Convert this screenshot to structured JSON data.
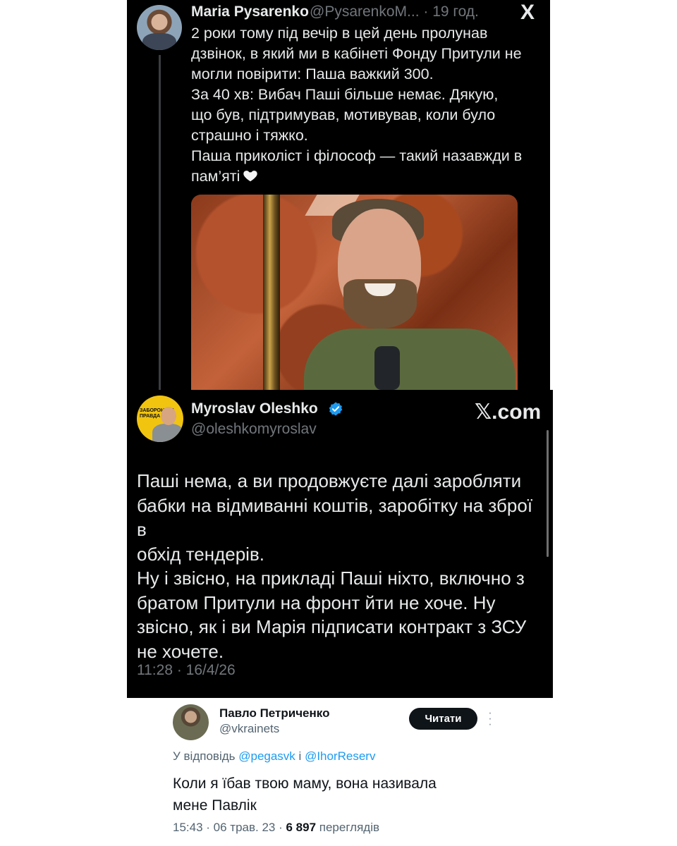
{
  "tweet1": {
    "name": "Maria Pysarenko",
    "handle": "@PysarenkoM... · 19 год.",
    "logo": "X",
    "body_lines": "2 роки тому під вечір в цей день пролунав\nдзвінок, в який ми в кабінеті Фонду Притули не\nмогли повірити: Паша важкий 300.\nЗа 40 хв: Вибач Паші більше немає. Дякую,\nщо був, підтримував, мотивував, коли було\nстрашно і тяжко.\nПаша приколіст і філософ — такий назавжди в\nпам’яті",
    "heart_icon": "white-heart-icon"
  },
  "tweet2": {
    "name": "Myroslav Oleshko",
    "handle": "@oleshkomyroslav",
    "site_label": "𝕏.com",
    "avatar_badge": "ЗАБОРОНЕНА ПРАВДА",
    "body": "Паші нема, а ви продовжуєте далі заробляти\nбабки на відмиванні коштів, заробітку на зброї в\nобхід тендерів.\nНу і звісно, на прикладі Паші ніхто, включно з\nбратом Притули на фронт йти не хоче. Ну\nзвісно, як і ви Марія підписати контракт з ЗСУ\nне хочете.",
    "timestamp": "11:28 · 16/4/26",
    "verified_color": "#1d9bf0"
  },
  "tweet3": {
    "name": "Павло Петриченко",
    "handle": "@vkrainets",
    "follow_label": "Читати",
    "reply_prefix": "У відповідь",
    "reply_user1": "@pegasvk",
    "reply_conj": "і",
    "reply_user2": "@IhorReserv",
    "body": "Коли я їбав твою маму, вона називала\nмене Павлік",
    "time": "15:43 · 06 трав. 23 ·",
    "views": "6 897",
    "views_label": "переглядів"
  }
}
